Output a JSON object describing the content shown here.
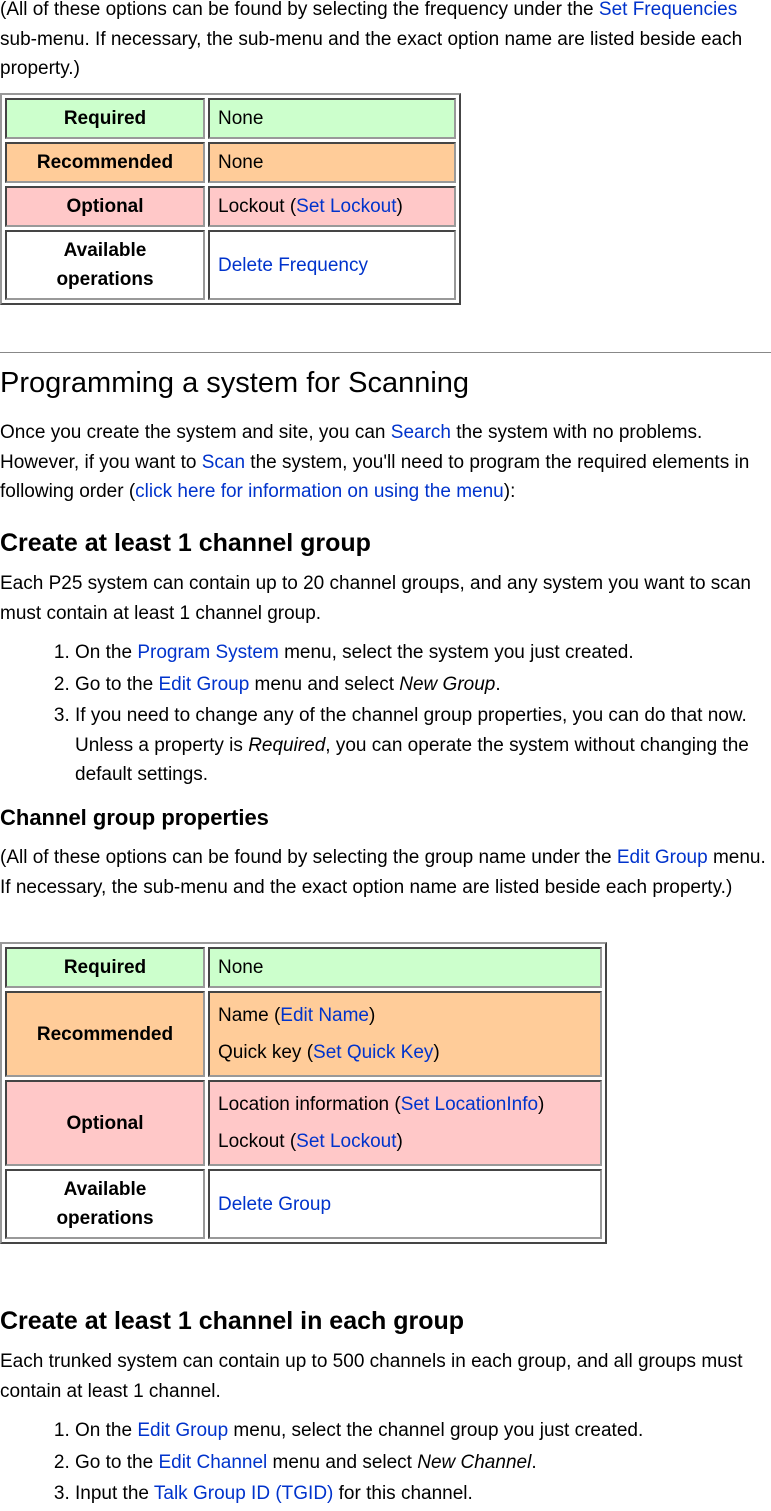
{
  "colors": {
    "required": "#ccffcc",
    "recommended": "#ffcc99",
    "optional": "#ffc8c8",
    "link": "#0033cc"
  },
  "intro1": [
    {
      "t": "(All of these options can be found by selecting the frequency under the "
    },
    {
      "t": "Set Frequencies",
      "link": true
    },
    {
      "t": " sub-menu. If necessary, the sub-menu and the exact option name are listed beside each property.)"
    }
  ],
  "table1": [
    {
      "key": "Required",
      "cls": "req",
      "lines": [
        [
          {
            "t": "None"
          }
        ]
      ]
    },
    {
      "key": "Recommended",
      "cls": "rec",
      "lines": [
        [
          {
            "t": "None"
          }
        ]
      ]
    },
    {
      "key": "Optional",
      "cls": "opt",
      "lines": [
        [
          {
            "t": "Lockout ("
          },
          {
            "t": "Set Lockout",
            "link": true
          },
          {
            "t": ")"
          }
        ]
      ]
    },
    {
      "key": "Available operations",
      "cls": "ops",
      "lines": [
        [
          {
            "t": "Delete Frequency",
            "link": true
          }
        ]
      ]
    }
  ],
  "section_title": "Programming a system for Scanning",
  "section_intro": [
    {
      "t": "Once you create the system and site, you can "
    },
    {
      "t": "Search",
      "link": true
    },
    {
      "t": " the system with no problems. However, if you want to "
    },
    {
      "t": "Scan",
      "link": true
    },
    {
      "t": " the system, you'll need to program the required elements in following order ("
    },
    {
      "t": "click here for information on using the menu",
      "link": true
    },
    {
      "t": "):"
    }
  ],
  "group_heading": "Create at least 1 channel group",
  "group_intro": [
    {
      "t": "Each P25 system can contain up to 20 channel groups, and any system you want to scan must contain at least 1 channel group."
    }
  ],
  "group_steps": [
    [
      {
        "t": "On the "
      },
      {
        "t": "Program System",
        "link": true
      },
      {
        "t": " menu, select the system you just created."
      }
    ],
    [
      {
        "t": "Go to the "
      },
      {
        "t": "Edit Group",
        "link": true
      },
      {
        "t": " menu and select "
      },
      {
        "t": "New Group",
        "em": true
      },
      {
        "t": "."
      }
    ],
    [
      {
        "t": "If you need to change any of the channel group properties, you can do that now. Unless a property is "
      },
      {
        "t": "Required",
        "em": true
      },
      {
        "t": ", you can operate the system without changing the default settings."
      }
    ]
  ],
  "group_props_heading": "Channel group properties",
  "intro2": [
    {
      "t": "(All of these options can be found by selecting the group name under the "
    },
    {
      "t": "Edit Group",
      "link": true
    },
    {
      "t": " menu. If necessary, the sub-menu and the exact option name are listed beside each property.)"
    }
  ],
  "table2": [
    {
      "key": "Required",
      "cls": "req",
      "lines": [
        [
          {
            "t": "None"
          }
        ]
      ]
    },
    {
      "key": "Recommended",
      "cls": "rec",
      "lines": [
        [
          {
            "t": "Name ("
          },
          {
            "t": "Edit Name",
            "link": true
          },
          {
            "t": ")"
          }
        ],
        [
          {
            "t": "Quick key ("
          },
          {
            "t": "Set Quick Key",
            "link": true
          },
          {
            "t": ")"
          }
        ]
      ]
    },
    {
      "key": "Optional",
      "cls": "opt",
      "lines": [
        [
          {
            "t": "Location information ("
          },
          {
            "t": "Set LocationInfo",
            "link": true
          },
          {
            "t": ")"
          }
        ],
        [
          {
            "t": "Lockout ("
          },
          {
            "t": "Set Lockout",
            "link": true
          },
          {
            "t": ")"
          }
        ]
      ]
    },
    {
      "key": "Available operations",
      "cls": "ops",
      "lines": [
        [
          {
            "t": "Delete Group",
            "link": true
          }
        ]
      ]
    }
  ],
  "channel_heading": "Create at least 1 channel in each group",
  "channel_intro": [
    {
      "t": "Each trunked system can contain up to 500 channels in each group, and all groups must contain at least 1 channel."
    }
  ],
  "channel_steps": [
    [
      {
        "t": "On the "
      },
      {
        "t": "Edit Group",
        "link": true
      },
      {
        "t": " menu, select the channel group you just created."
      }
    ],
    [
      {
        "t": "Go to the "
      },
      {
        "t": "Edit Channel",
        "link": true
      },
      {
        "t": " menu and select "
      },
      {
        "t": "New Channel",
        "em": true
      },
      {
        "t": "."
      }
    ],
    [
      {
        "t": "Input the "
      },
      {
        "t": "Talk Group ID (TGID)",
        "link": true
      },
      {
        "t": " for this channel."
      }
    ]
  ]
}
